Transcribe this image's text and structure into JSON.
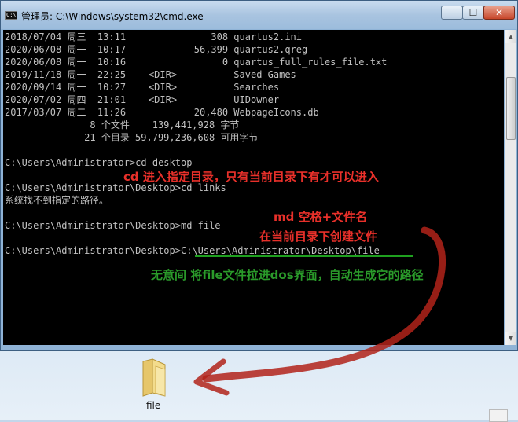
{
  "window": {
    "title": "管理员: C:\\Windows\\system32\\cmd.exe",
    "icon_text": "C:\\",
    "controls": {
      "minimize": "—",
      "maximize": "☐",
      "close": "✕"
    }
  },
  "console": {
    "lines": [
      "2018/07/04 周三  13:11               308 quartus2.ini",
      "2020/06/08 周一  10:17            56,399 quartus2.qreg",
      "2020/06/08 周一  10:16                 0 quartus_full_rules_file.txt",
      "2019/11/18 周一  22:25    <DIR>          Saved Games",
      "2020/09/14 周一  10:27    <DIR>          Searches",
      "2020/07/02 周四  21:01    <DIR>          UIDowner",
      "2017/03/07 周二  11:26            20,480 WebpageIcons.db",
      "               8 个文件    139,441,928 字节",
      "              21 个目录 59,799,236,608 可用字节",
      "",
      "C:\\Users\\Administrator>cd desktop",
      "",
      "C:\\Users\\Administrator\\Desktop>cd links",
      "系统找不到指定的路径。",
      "",
      "C:\\Users\\Administrator\\Desktop>md file",
      "",
      "C:\\Users\\Administrator\\Desktop>C:\\Users\\Administrator\\Desktop\\file"
    ]
  },
  "annotations": {
    "cd": "cd 进入指定目录，只有当前目录下有才可以进入",
    "md1": "md 空格+文件名",
    "md2": "在当前目录下创建文件",
    "drag": "无意间 将file文件拉进dos界面，自动生成它的路径"
  },
  "desktop": {
    "file_label": "file"
  },
  "colors": {
    "annotation_red": "#e8302a",
    "annotation_green": "#2a9a2a",
    "console_bg": "#000000",
    "console_text": "#c0c0c0"
  }
}
